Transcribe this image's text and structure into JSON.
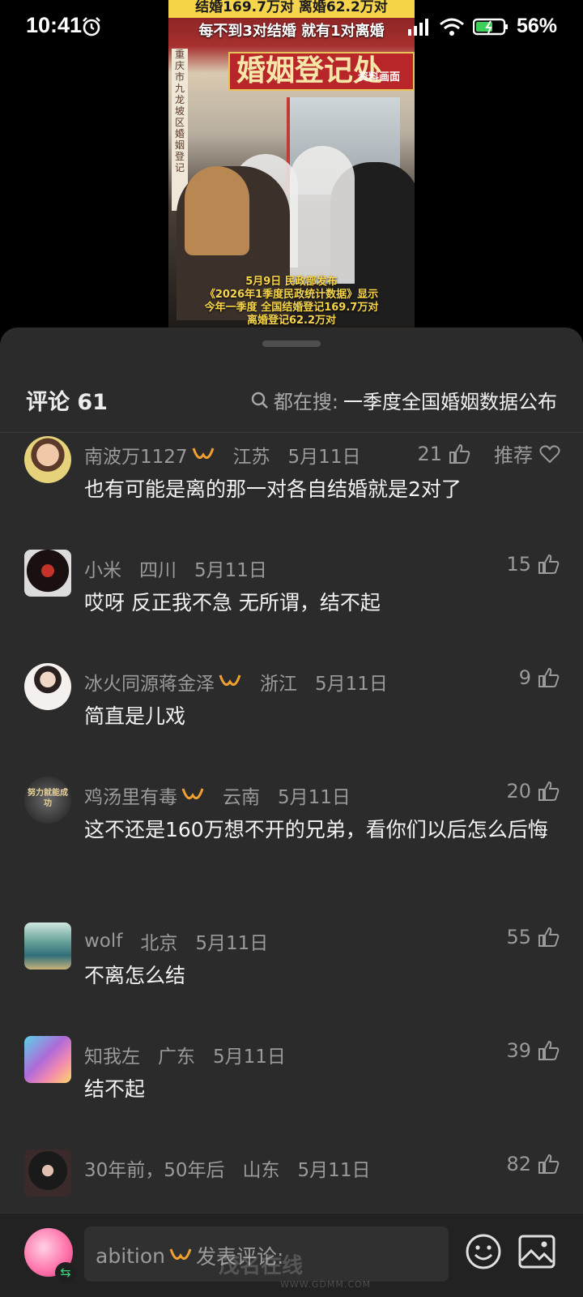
{
  "status_bar": {
    "time": "10:41",
    "battery": "56%"
  },
  "video": {
    "top_band": "结婚169.7万对 离婚62.2万对",
    "subtitle": "每不到3对结婚 就有1对离婚",
    "sign": "婚姻登记处",
    "source": "资料画面",
    "plaque": "重庆市九龙坡区婚姻登记",
    "caption_line1": "5月9日 民政部发布",
    "caption_line2": "《2026年1季度民政统计数据》显示",
    "caption_line3": "今年一季度 全国结婚登记169.7万对",
    "caption_line4": "离婚登记62.2万对"
  },
  "header": {
    "title": "评论 61",
    "search_label": "都在搜:",
    "search_query": "一季度全国婚姻数据公布"
  },
  "comments": [
    {
      "user": "南波万1127",
      "location": "江苏",
      "date": "5月11日",
      "likes": "21",
      "recommend": "推荐",
      "text": "也有可能是离的那一对各自结婚就是2对了"
    },
    {
      "user": "小米",
      "location": "四川",
      "date": "5月11日",
      "likes": "15",
      "text": "哎呀 反正我不急 无所谓，结不起"
    },
    {
      "user": "冰火同源蒋金泽",
      "location": "浙江",
      "date": "5月11日",
      "likes": "9",
      "text": "简直是儿戏"
    },
    {
      "user": "鸡汤里有毒",
      "location": "云南",
      "date": "5月11日",
      "likes": "20",
      "text": "这不还是160万想不开的兄弟，看你们以后怎么后悔",
      "avatar_text": "努力就能成功"
    },
    {
      "user": "wolf",
      "location": "北京",
      "date": "5月11日",
      "likes": "55",
      "text": "不离怎么结"
    },
    {
      "user": "知我左",
      "location": "广东",
      "date": "5月11日",
      "likes": "39",
      "text": "结不起"
    },
    {
      "user": "30年前，50年后",
      "location": "山东",
      "date": "5月11日",
      "likes": "82",
      "text": ""
    }
  ],
  "input": {
    "username": "abition",
    "placeholder": "发表评论:"
  },
  "watermark": {
    "name": "茂名在线",
    "url": "WWW.GDMM.COM"
  },
  "colors": {
    "sheet_bg": "#2b2b2b",
    "badge": "#f0a030",
    "caption_yellow": "#f7d54a"
  }
}
